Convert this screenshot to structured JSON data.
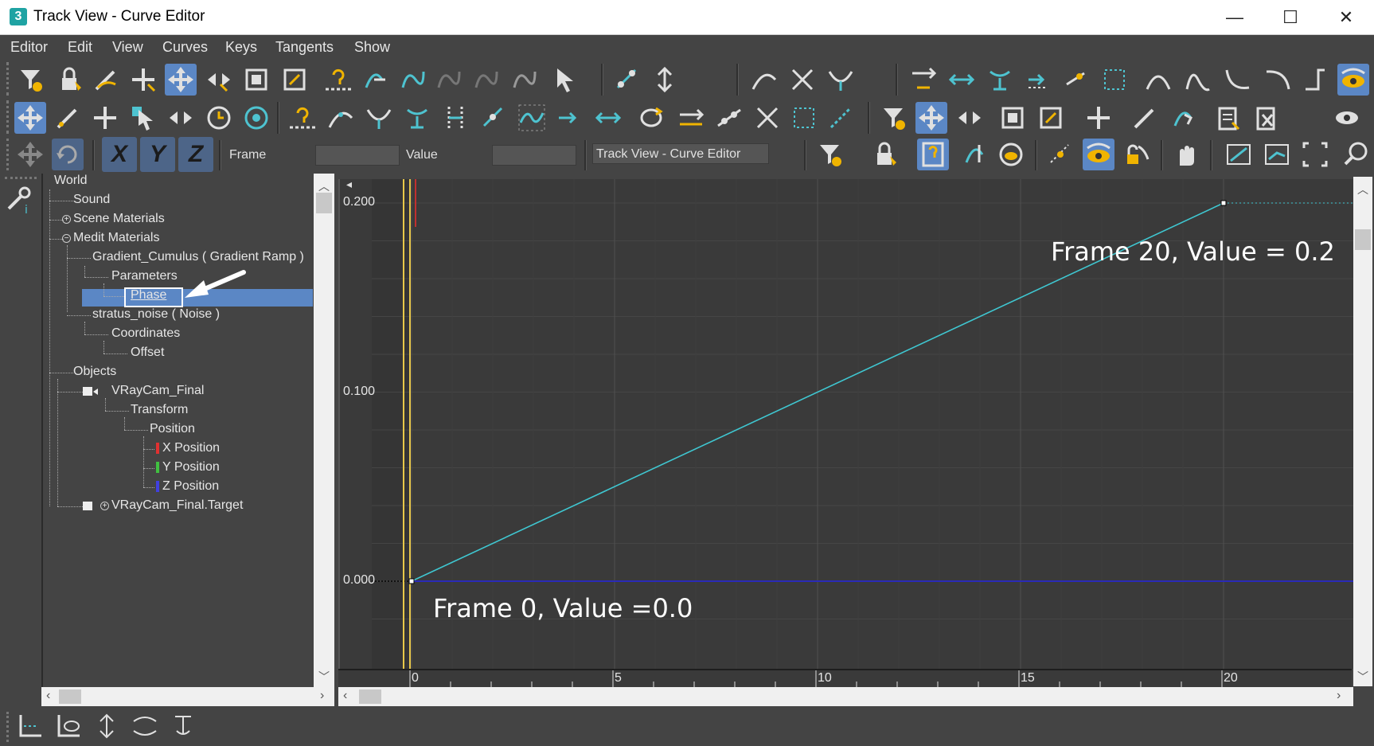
{
  "window": {
    "title": "Track View - Curve Editor",
    "app_icon_text": "3",
    "minimize": "—",
    "maximize": "☐",
    "close": "✕"
  },
  "menu": [
    "Editor",
    "Edit",
    "View",
    "Curves",
    "Keys",
    "Tangents",
    "Show"
  ],
  "toolbar3": {
    "frame_label": "Frame",
    "value_label": "Value",
    "frame_value": "",
    "value_value": "",
    "name_field": "Track View - Curve Editor",
    "axis_buttons": [
      "X",
      "Y",
      "Z"
    ]
  },
  "tree": {
    "items": [
      {
        "label": "World"
      },
      {
        "label": "Sound"
      },
      {
        "label": "Scene Materials"
      },
      {
        "label": "Medit Materials"
      },
      {
        "label": "Gradient_Cumulus  ( Gradient Ramp )"
      },
      {
        "label": "Parameters"
      },
      {
        "label": "Phase"
      },
      {
        "label": "stratus_noise  ( Noise )"
      },
      {
        "label": "Coordinates"
      },
      {
        "label": "Offset"
      },
      {
        "label": "Objects"
      },
      {
        "label": "VRayCam_Final"
      },
      {
        "label": "Transform"
      },
      {
        "label": "Position"
      },
      {
        "label": "X Position"
      },
      {
        "label": "Y Position"
      },
      {
        "label": "Z Position"
      },
      {
        "label": "VRayCam_Final.Target"
      }
    ]
  },
  "graph": {
    "y_ticks": [
      "0.200",
      "0.100",
      "0.000"
    ],
    "x_ticks": [
      "0",
      "5",
      "10",
      "15",
      "20"
    ],
    "annotation_start": "Frame 0, Value =0.0",
    "annotation_end": "Frame 20, Value = 0.2",
    "curve_color": "#3fc7d1",
    "time_slider_color": "#e8c84a"
  },
  "chart_data": {
    "type": "line",
    "series": [
      {
        "values": [
          [
            0,
            0.0
          ],
          [
            20,
            0.2
          ]
        ]
      }
    ],
    "xlim": [
      -1,
      20.5
    ],
    "ylim": [
      -0.02,
      0.22
    ],
    "x_ticks": [
      0,
      5,
      10,
      15,
      20
    ],
    "y_ticks": [
      0.0,
      0.1,
      0.2
    ]
  },
  "colors": {
    "selection": "#5b87c5",
    "accent_blue": "#4ec3d0",
    "background": "#444444"
  }
}
